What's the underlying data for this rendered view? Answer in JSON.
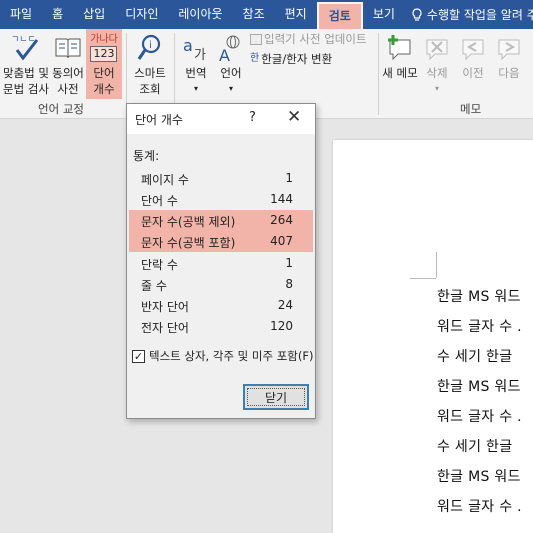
{
  "tabs": [
    "파일",
    "홈",
    "삽입",
    "디자인",
    "레이아웃",
    "참조",
    "편지",
    "검토",
    "보기"
  ],
  "tell_me": "수행할 작업을 알려 주세",
  "ribbon": {
    "spelling": [
      "맞춤법 및",
      "문법 검사"
    ],
    "thesaurus": [
      "동의어",
      "사전"
    ],
    "wordcount_icon": [
      "가나다",
      "123"
    ],
    "wordcount": [
      "단어",
      "개수"
    ],
    "smart_lookup": [
      "스마트",
      "조회"
    ],
    "translate": "번역",
    "language": "언어",
    "ime_update": "입력기 사전 업데이트",
    "hanja": "한글/한자 변환",
    "new_memo": "새 메모",
    "delete": "삭제",
    "prev": "이전",
    "next": "다음",
    "group_language": "언어 교정",
    "group_memo": "메모"
  },
  "dialog": {
    "title": "단어 개수",
    "help": "?",
    "close_x": "✕",
    "stats_label": "통계:",
    "rows": [
      {
        "label": "페이지 수",
        "value": "1"
      },
      {
        "label": "단어 수",
        "value": "144"
      },
      {
        "label": "문자 수(공백 제외)",
        "value": "264"
      },
      {
        "label": "문자 수(공백 포함)",
        "value": "407"
      },
      {
        "label": "단락 수",
        "value": "1"
      },
      {
        "label": "줄 수",
        "value": "8"
      },
      {
        "label": "반자 단어",
        "value": "24"
      },
      {
        "label": "전자 단어",
        "value": "120"
      }
    ],
    "checkbox_label": "텍스트 상자, 각주 및 미주 포함(F)",
    "checkbox_checked": "✓",
    "close_button": "닫기"
  },
  "document": {
    "lines": [
      "한글 MS 워드",
      "워드 글자 수 .",
      "수 세기 한글",
      "한글 MS 워드",
      "워드 글자 수 .",
      "수 세기 한글",
      "한글 MS 워드",
      "워드 글자 수 ."
    ]
  },
  "colors": {
    "tabbar": "#2b579a",
    "highlight": "#f2b4a8",
    "ribbon": "#f3f3f3",
    "dialog": "#f0f0f0"
  }
}
